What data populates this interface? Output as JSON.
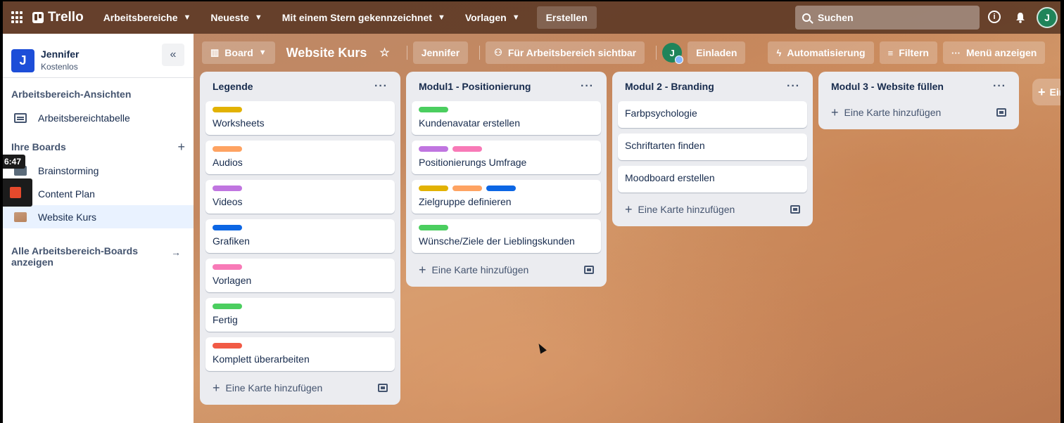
{
  "topbar": {
    "app_name": "Trello",
    "nav": [
      {
        "label": "Arbeitsbereiche"
      },
      {
        "label": "Neueste"
      },
      {
        "label": "Mit einem Stern gekennzeichnet"
      },
      {
        "label": "Vorlagen"
      }
    ],
    "create_label": "Erstellen",
    "search_placeholder": "Suchen",
    "avatar_initial": "J"
  },
  "sidebar": {
    "workspace": {
      "initial": "J",
      "name": "Jennifer",
      "plan": "Kostenlos"
    },
    "views_heading": "Arbeitsbereich-Ansichten",
    "views": [
      {
        "label": "Arbeitsbereichtabelle"
      }
    ],
    "boards_heading": "Ihre Boards",
    "boards": [
      {
        "label": "Brainstorming"
      },
      {
        "label": "Content Plan"
      },
      {
        "label": "Website Kurs",
        "active": true
      }
    ],
    "all_boards_label": "Alle Arbeitsbereich-Boards anzeigen",
    "timestamp": "6:47"
  },
  "board_header": {
    "view_label": "Board",
    "title": "Website Kurs",
    "workspace_label": "Jennifer",
    "visibility_label": "Für Arbeitsbereich sichtbar",
    "member_initial": "J",
    "invite_label": "Einladen",
    "automation_label": "Automatisierung",
    "filter_label": "Filtern",
    "menu_label": "Menü anzeigen"
  },
  "colors": {
    "yellow": "#e2b203",
    "orange": "#fea362",
    "purple": "#c075e0",
    "blue": "#0c66e4",
    "pink": "#f87ab7",
    "green": "#4bce5f",
    "red": "#f15a45"
  },
  "lists": [
    {
      "title": "Legende",
      "cards": [
        {
          "text": "Worksheets",
          "labels": [
            "yellow"
          ]
        },
        {
          "text": "Audios",
          "labels": [
            "orange"
          ]
        },
        {
          "text": "Videos",
          "labels": [
            "purple"
          ]
        },
        {
          "text": "Grafiken",
          "labels": [
            "blue"
          ]
        },
        {
          "text": "Vorlagen",
          "labels": [
            "pink"
          ]
        },
        {
          "text": "Fertig",
          "labels": [
            "green"
          ]
        },
        {
          "text": "Komplett überarbeiten",
          "labels": [
            "red"
          ]
        }
      ],
      "add_label": "Eine Karte hinzufügen"
    },
    {
      "title": "Modul1 - Positionierung",
      "cards": [
        {
          "text": "Kundenavatar erstellen",
          "labels": [
            "green"
          ]
        },
        {
          "text": "Positionierungs Umfrage",
          "labels": [
            "purple",
            "pink"
          ]
        },
        {
          "text": "Zielgruppe definieren",
          "labels": [
            "yellow",
            "orange",
            "blue"
          ]
        },
        {
          "text": "Wünsche/Ziele der Lieblingskunden",
          "labels": [
            "green"
          ]
        }
      ],
      "add_label": "Eine Karte hinzufügen"
    },
    {
      "title": "Modul 2 - Branding",
      "cards": [
        {
          "text": "Farbpsychologie",
          "labels": []
        },
        {
          "text": "Schriftarten finden",
          "labels": []
        },
        {
          "text": "Moodboard erstellen",
          "labels": []
        }
      ],
      "add_label": "Eine Karte hinzufügen"
    },
    {
      "title": "Modul 3 - Website füllen",
      "cards": [],
      "add_label": "Eine Karte hinzufügen"
    }
  ],
  "add_list_label": "Ein"
}
